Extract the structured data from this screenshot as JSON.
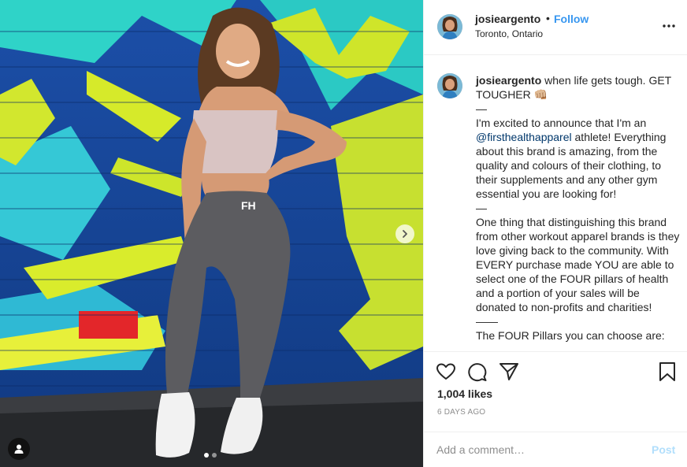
{
  "post": {
    "username": "josieargento",
    "separator": "•",
    "follow_label": "Follow",
    "location": "Toronto, Ontario",
    "more_icon": "more-options-icon"
  },
  "caption": {
    "username": "josieargento",
    "lines": {
      "l1": " when life gets tough. GET TOUGHER 👊🏼\n—\nI'm excited to announce that I'm an ",
      "mention": "@firsthealthapparel",
      "l2": " athlete! Everything about this brand is amazing, from the quality and colours of their clothing, to their supplements and any other gym essential you are looking for!\n—\nOne thing that distinguishing this brand from other workout apparel brands is they love giving back to the community. With EVERY purchase made YOU are able to select one of the FOUR pillars of health and a portion of your sales will be donated to non-profits and charities!\n——\nThe FOUR Pillars you can choose are:"
    }
  },
  "actions": {
    "likes": "1,004 likes",
    "timestamp": "6 DAYS AGO",
    "icons": [
      "heart-icon",
      "comment-icon",
      "share-icon",
      "bookmark-icon"
    ]
  },
  "comment_form": {
    "placeholder": "Add a comment…",
    "post_label": "Post"
  },
  "carousel": {
    "current": 1,
    "total": 2
  },
  "colors": {
    "link": "#3897f0",
    "mention": "#00376b",
    "muted": "#8e8e8e",
    "post_disabled": "#b2dffc"
  }
}
